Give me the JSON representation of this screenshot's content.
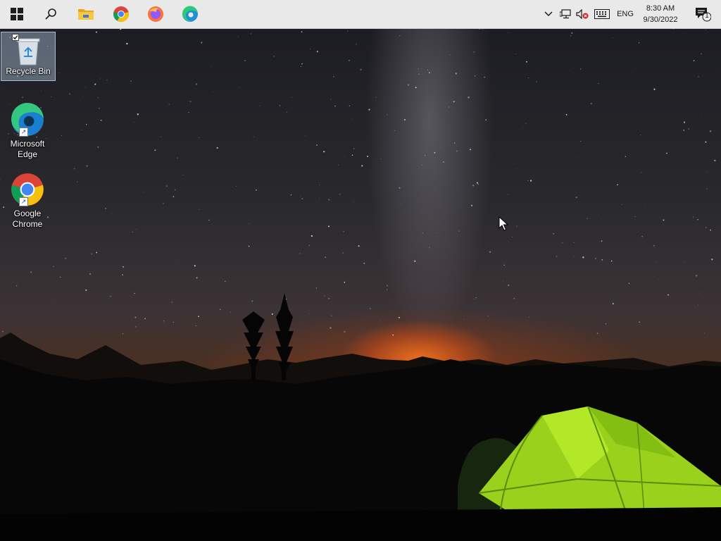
{
  "taskbar": {
    "apps": [
      {
        "name": "start",
        "icon": "windows-logo-icon"
      },
      {
        "name": "search",
        "icon": "search-icon"
      },
      {
        "name": "file-explorer",
        "icon": "folder-icon"
      },
      {
        "name": "google-chrome",
        "icon": "chrome-icon"
      },
      {
        "name": "firefox",
        "icon": "firefox-icon"
      },
      {
        "name": "microsoft-edge",
        "icon": "edge-icon"
      }
    ],
    "tray": {
      "language": "ENG",
      "time": "8:30 AM",
      "date": "9/30/2022",
      "notification_count": "1",
      "icons": [
        "chevron-up-icon",
        "network-icon",
        "speaker-muted-icon",
        "keyboard-icon",
        "action-center-icon"
      ]
    },
    "colors": {
      "bar": "#e9e9e9"
    }
  },
  "desktop": {
    "icons": [
      {
        "label": "Recycle Bin",
        "icon": "recycle-bin-icon",
        "selected": true
      },
      {
        "label": "Microsoft Edge",
        "icon": "edge-icon",
        "shortcut": true
      },
      {
        "label": "Google Chrome",
        "icon": "chrome-icon",
        "shortcut": true
      }
    ],
    "wallpaper": "night-sky-milky-way-tent-icon"
  }
}
